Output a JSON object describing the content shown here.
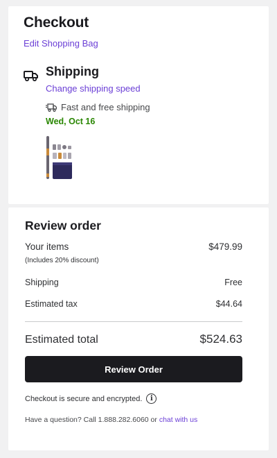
{
  "checkout": {
    "title": "Checkout",
    "edit_bag_link": "Edit Shopping Bag",
    "shipping": {
      "icon": "truck-icon",
      "title": "Shipping",
      "change_speed_link": "Change shipping speed",
      "option_icon": "fast-delivery-icon",
      "option_label": "Fast and free shipping",
      "date": "Wed, Oct 16"
    },
    "product_image": "hair-styler-product"
  },
  "review": {
    "title": "Review order",
    "items_label": "Your items",
    "items_value": "$479.99",
    "discount_note": "(Includes 20% discount)",
    "shipping_label": "Shipping",
    "shipping_value": "Free",
    "tax_label": "Estimated tax",
    "tax_value": "$44.64",
    "total_label": "Estimated total",
    "total_value": "$524.63",
    "button_label": "Review Order",
    "secure_text": "Checkout is secure and encrypted.",
    "info_icon": "info-icon",
    "question_text": "Have a question? Call 1.888.282.6060 or",
    "chat_link": "chat with us"
  },
  "colors": {
    "link": "#6b3fd6",
    "date_green": "#2a8703",
    "button_bg": "#1b1b1f",
    "page_bg": "#f1f1f2"
  }
}
